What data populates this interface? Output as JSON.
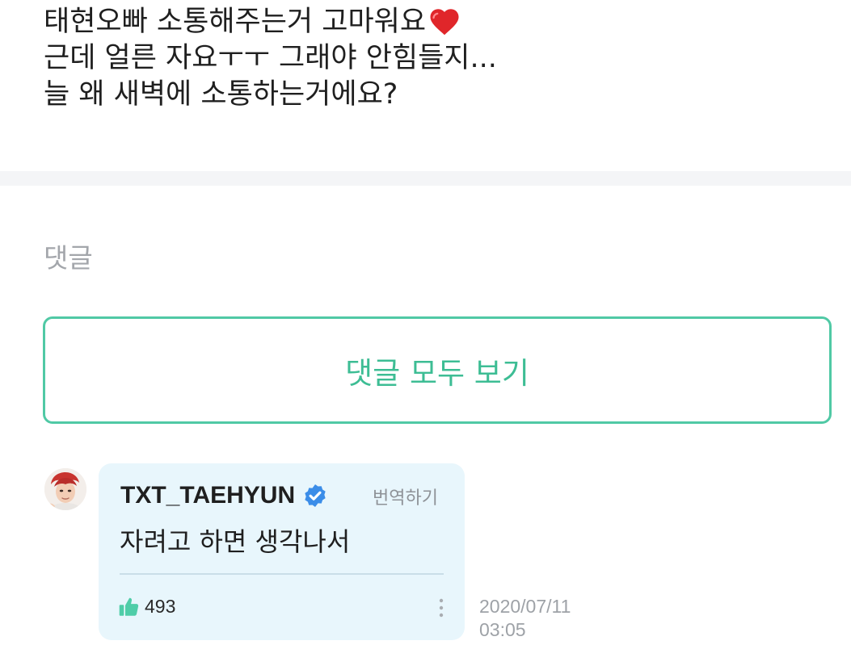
{
  "post": {
    "lines": [
      "태현오빠 소통해주는거 고마워요",
      "근데 얼른 자요ㅜㅜ 그래야 안힘들지...",
      "늘 왜 새벽에 소통하는거에요?"
    ],
    "trailing_icon": "red-heart-icon"
  },
  "comments": {
    "heading": "댓글",
    "view_all_label": "댓글 모두 보기",
    "items": [
      {
        "author": "TXT_TAEHYUN",
        "verified": true,
        "translate_label": "번역하기",
        "text": "자려고 하면 생각나서",
        "likes": "493",
        "date": "2020/07/11",
        "time": "03:05"
      }
    ]
  },
  "colors": {
    "accent": "#3dbd94",
    "bubble_bg": "#e8f6fc",
    "verified": "#3b8de8",
    "like_icon": "#4fcda8",
    "divider": "#f4f5f7"
  },
  "icons": [
    "red-heart-icon",
    "verified-badge-icon",
    "thumbs-up-icon",
    "more-vertical-icon",
    "avatar"
  ]
}
